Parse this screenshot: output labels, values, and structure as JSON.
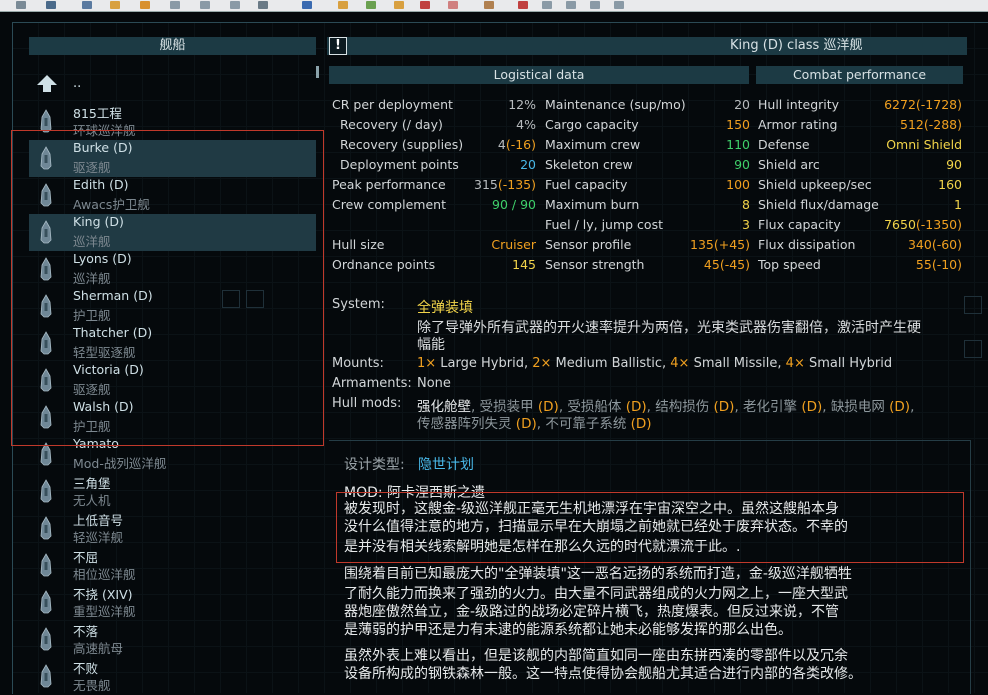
{
  "left_panel": {
    "header": "舰船",
    "up_label": "..",
    "ships": [
      {
        "name": "815工程",
        "class": "环球巡洋舰"
      },
      {
        "name": "Burke (D)",
        "class": "驱逐舰"
      },
      {
        "name": "Edith (D)",
        "class": "Awacs护卫舰"
      },
      {
        "name": "King (D)",
        "class": "巡洋舰"
      },
      {
        "name": "Lyons (D)",
        "class": "巡洋舰"
      },
      {
        "name": "Sherman (D)",
        "class": "护卫舰"
      },
      {
        "name": "Thatcher (D)",
        "class": "轻型驱逐舰"
      },
      {
        "name": "Victoria (D)",
        "class": "驱逐舰"
      },
      {
        "name": "Walsh (D)",
        "class": "护卫舰"
      },
      {
        "name": "Yamato",
        "class": "Mod-战列巡洋舰"
      },
      {
        "name": "三角堡",
        "class": "无人机"
      },
      {
        "name": "上低音号",
        "class": "轻巡洋舰"
      },
      {
        "name": "不屈",
        "class": "相位巡洋舰"
      },
      {
        "name": "不挠 (XIV)",
        "class": "重型巡洋舰"
      },
      {
        "name": "不落",
        "class": "高速航母"
      },
      {
        "name": "不败",
        "class": "无畏舰"
      }
    ]
  },
  "right_panel": {
    "info_icon": "!",
    "title": "King (D) class 巡洋舰",
    "logistical_header": "Logistical data",
    "combat_header": "Combat performance",
    "col1": [
      {
        "label": "CR per deployment",
        "value": "12%",
        "delta": ""
      },
      {
        "label": "Recovery (/ day)",
        "value": "4%",
        "delta": ""
      },
      {
        "label": "Recovery (supplies)",
        "value": "4",
        "delta": "(-16)"
      },
      {
        "label": "Deployment points",
        "value": "20",
        "delta": ""
      },
      {
        "label": "Peak performance",
        "value": "315",
        "delta": "(-135)"
      },
      {
        "label": "Crew complement",
        "value": "90 / 90",
        "delta": ""
      },
      {
        "label": "Hull size",
        "value": "Cruiser",
        "delta": ""
      },
      {
        "label": "Ordnance points",
        "value": "145",
        "delta": ""
      }
    ],
    "col2": [
      {
        "label": "Maintenance (sup/mo)",
        "value": "20",
        "delta": ""
      },
      {
        "label": "Cargo capacity",
        "value": "150",
        "delta": ""
      },
      {
        "label": "Maximum crew",
        "value": "110",
        "delta": ""
      },
      {
        "label": "Skeleton crew",
        "value": "90",
        "delta": ""
      },
      {
        "label": "Fuel capacity",
        "value": "100",
        "delta": ""
      },
      {
        "label": "Maximum burn",
        "value": "8",
        "delta": ""
      },
      {
        "label": "Fuel / ly, jump cost",
        "value": "3",
        "delta": ""
      },
      {
        "label": "Sensor profile",
        "value": "135",
        "delta": "(+45)"
      },
      {
        "label": "Sensor strength",
        "value": "45",
        "delta": "(-45)"
      }
    ],
    "col3": [
      {
        "label": "Hull integrity",
        "value": "6272",
        "delta": "(-1728)"
      },
      {
        "label": "Armor rating",
        "value": "512",
        "delta": "(-288)"
      },
      {
        "label": "Defense",
        "value": "Omni Shield",
        "delta": ""
      },
      {
        "label": "Shield arc",
        "value": "90",
        "delta": ""
      },
      {
        "label": "Shield upkeep/sec",
        "value": "160",
        "delta": ""
      },
      {
        "label": "Shield flux/damage",
        "value": "1",
        "delta": ""
      },
      {
        "label": "Flux capacity",
        "value": "7650",
        "delta": "(-1350)"
      },
      {
        "label": "Flux dissipation",
        "value": "340",
        "delta": "(-60)"
      },
      {
        "label": "Top speed",
        "value": "55",
        "delta": "(-10)"
      }
    ],
    "system_label": "System:",
    "system_name": "全弹装填",
    "system_desc_1": "除了导弹外所有武器的开火速率提升为两倍，光束类武器伤害翻倍，激活时产生硬",
    "system_desc_2": "幅能",
    "mounts_label": "Mounts:",
    "mounts": [
      {
        "count": "1×",
        "name": " Large Hybrid, "
      },
      {
        "count": "2×",
        "name": " Medium Ballistic, "
      },
      {
        "count": "4×",
        "name": " Small Missile, "
      },
      {
        "count": "4×",
        "name": " Small Hybrid"
      }
    ],
    "armaments_label": "Armaments:",
    "armaments_value": "None",
    "hullmods_label": "Hull mods:",
    "hullmods_line1": [
      {
        "text": "强化舱壁",
        "kind": "main"
      },
      {
        "text": ", 受损装甲 ",
        "kind": "dim"
      },
      {
        "text": "(D)",
        "kind": "d"
      },
      {
        "text": ", 受损船体 ",
        "kind": "dim"
      },
      {
        "text": "(D)",
        "kind": "d"
      },
      {
        "text": ", 结构损伤 ",
        "kind": "dim"
      },
      {
        "text": "(D)",
        "kind": "d"
      },
      {
        "text": ", 老化引擎 ",
        "kind": "dim"
      },
      {
        "text": "(D)",
        "kind": "d"
      },
      {
        "text": ", 缺损电网 ",
        "kind": "dim"
      },
      {
        "text": "(D)",
        "kind": "d"
      },
      {
        "text": ",",
        "kind": "dim"
      }
    ],
    "hullmods_line2": [
      {
        "text": "传感器阵列失灵 ",
        "kind": "dim"
      },
      {
        "text": "(D)",
        "kind": "d"
      },
      {
        "text": ", 不可靠子系统 ",
        "kind": "dim"
      },
      {
        "text": "(D)",
        "kind": "d"
      }
    ],
    "design_label": "设计类型:",
    "design_value": "隐世计划",
    "mod_line": "MOD: 阿卡涅西斯之遗",
    "desc_lines": [
      "被发现时，这艘金-级巡洋舰正毫无生机地漂浮在宇宙深空之中。虽然这艘船本身",
      "没什么值得注意的地方，扫描显示早在大崩塌之前她就已经处于废弃状态。不幸的",
      "是并没有相关线索解明她是怎样在那么久远的时代就漂流于此。.",
      "围绕着目前已知最庞大的\"全弹装填\"这一恶名远扬的系统而打造，金-级巡洋舰牺牲",
      "了耐久能力而换来了强劲的火力。由大量不同武器组成的火力网之上，一座大型武",
      "器炮座傲然耸立，金-级路过的战场必定碎片横飞，热度爆表。但反过来说，不管",
      "是薄弱的护甲还是力有未逮的能源系统都让她未必能够发挥的那么出色。",
      "虽然外表上难以看出，但是该舰的内部简直如同一座由东拼西凑的零部件以及冗余",
      "设备所构成的钢铁森林一般。这一特点使得协会舰船尤其适合进行内部的各类改修。"
    ]
  }
}
